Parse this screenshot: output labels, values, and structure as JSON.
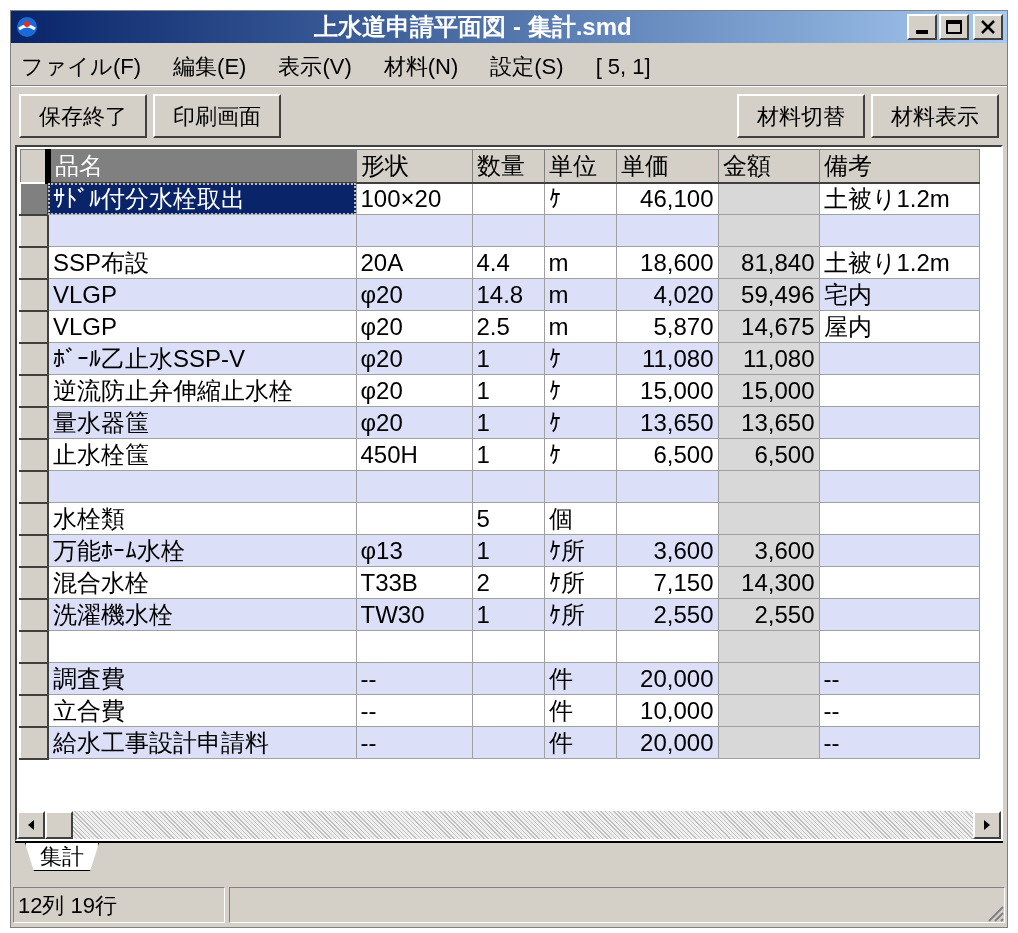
{
  "window": {
    "title": "上水道申請平面図 - 集計.smd"
  },
  "menu": [
    {
      "label": "ファイル(F)"
    },
    {
      "label": "編集(E)"
    },
    {
      "label": "表示(V)"
    },
    {
      "label": "材料(N)"
    },
    {
      "label": "設定(S)"
    },
    {
      "label": "[ 5, 1]"
    }
  ],
  "toolbar": {
    "left": [
      "保存終了",
      "印刷画面"
    ],
    "right": [
      "材料切替",
      "材料表示"
    ]
  },
  "table": {
    "columns": [
      "品名",
      "形状",
      "数量",
      "単位",
      "単価",
      "金額",
      "備考"
    ],
    "rows": [
      {
        "selected": true,
        "cells": {
          "name": "ｻﾄﾞﾙ付分水栓取出",
          "shape": "100×20",
          "unit": "ｹ",
          "price": "46,100",
          "note": "土被り1.2m"
        }
      },
      {
        "selected": false,
        "cells": {}
      },
      {
        "selected": false,
        "cells": {
          "name": "SSP布設",
          "shape": "20A",
          "qty": "4.4",
          "unit": "m",
          "price": "18,600",
          "amount": "81,840",
          "note": "土被り1.2m"
        }
      },
      {
        "selected": false,
        "cells": {
          "name": "VLGP",
          "shape": "φ20",
          "qty": "14.8",
          "unit": "m",
          "price": "4,020",
          "amount": "59,496",
          "note": "宅内"
        }
      },
      {
        "selected": false,
        "cells": {
          "name": "VLGP",
          "shape": "φ20",
          "qty": "2.5",
          "unit": "m",
          "price": "5,870",
          "amount": "14,675",
          "note": "屋内"
        }
      },
      {
        "selected": false,
        "cells": {
          "name": "ﾎﾞｰﾙ乙止水SSP-V",
          "shape": "φ20",
          "qty": "1",
          "unit": "ｹ",
          "price": "11,080",
          "amount": "11,080"
        }
      },
      {
        "selected": false,
        "cells": {
          "name": "逆流防止弁伸縮止水栓",
          "shape": "φ20",
          "qty": "1",
          "unit": "ｹ",
          "price": "15,000",
          "amount": "15,000"
        }
      },
      {
        "selected": false,
        "cells": {
          "name": "量水器筺",
          "shape": "φ20",
          "qty": "1",
          "unit": "ｹ",
          "price": "13,650",
          "amount": "13,650"
        }
      },
      {
        "selected": false,
        "cells": {
          "name": "止水栓筺",
          "shape": "450H",
          "qty": "1",
          "unit": "ｹ",
          "price": "6,500",
          "amount": "6,500"
        }
      },
      {
        "selected": false,
        "cells": {}
      },
      {
        "selected": false,
        "cells": {
          "name": "水栓類",
          "qty": "5",
          "unit": "個"
        }
      },
      {
        "selected": false,
        "cells": {
          "name": "万能ﾎｰﾑ水栓",
          "shape": "φ13",
          "qty": "1",
          "unit": "ｹ所",
          "price": "3,600",
          "amount": "3,600"
        }
      },
      {
        "selected": false,
        "cells": {
          "name": "混合水栓",
          "shape": "T33B",
          "qty": "2",
          "unit": "ｹ所",
          "price": "7,150",
          "amount": "14,300"
        }
      },
      {
        "selected": false,
        "cells": {
          "name": "洗濯機水栓",
          "shape": "TW30",
          "qty": "1",
          "unit": "ｹ所",
          "price": "2,550",
          "amount": "2,550"
        }
      },
      {
        "selected": false,
        "cells": {}
      },
      {
        "selected": false,
        "cells": {
          "name": "調査費",
          "shape": "--",
          "unit": "件",
          "price": "20,000",
          "note": "--"
        }
      },
      {
        "selected": false,
        "cells": {
          "name": "立合費",
          "shape": "--",
          "unit": "件",
          "price": "10,000",
          "note": "--"
        }
      },
      {
        "selected": false,
        "cells": {
          "name": "給水工事設計申請料",
          "shape": "--",
          "unit": "件",
          "price": "20,000",
          "note": "--"
        }
      }
    ]
  },
  "sheet_tabs": [
    {
      "label": "集計",
      "selected": true
    }
  ],
  "status_bar": {
    "text": "12列 19行"
  }
}
